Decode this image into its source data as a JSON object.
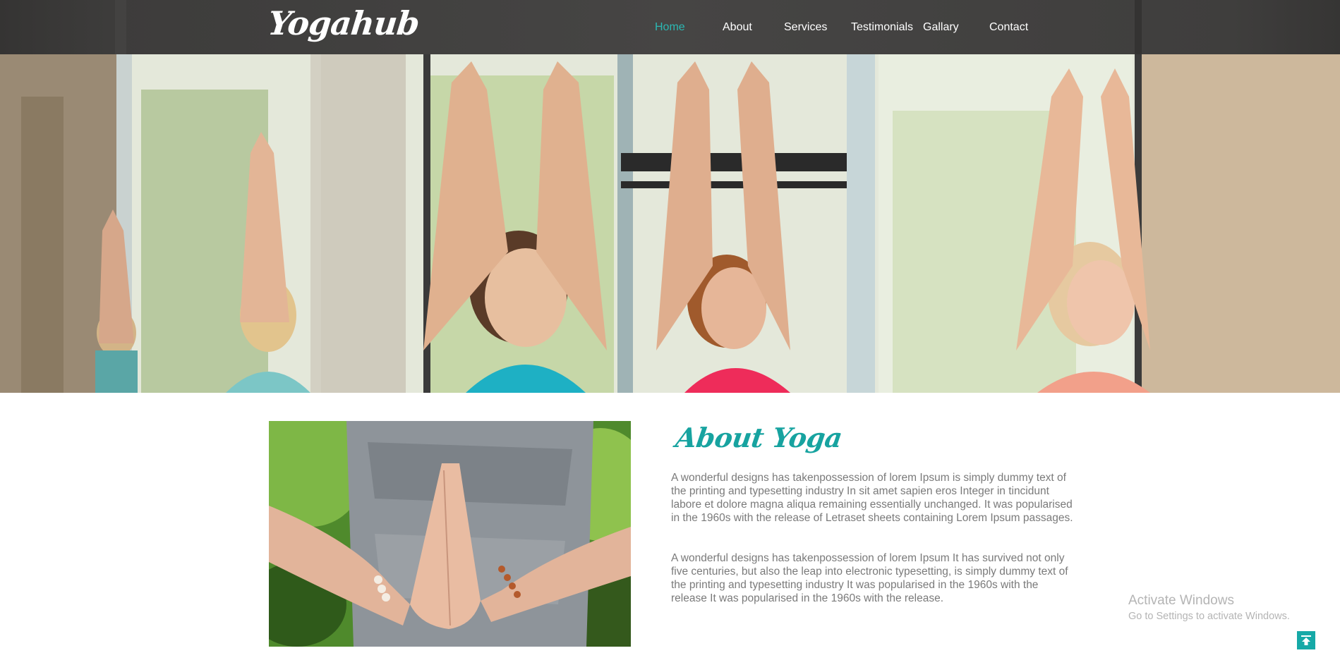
{
  "brand": {
    "logo": "Yogahub"
  },
  "nav": {
    "items": [
      {
        "label": "Home",
        "active": true
      },
      {
        "label": "About",
        "active": false
      },
      {
        "label": "Services",
        "active": false
      },
      {
        "label": "Testimonials",
        "active": false
      },
      {
        "label": "Gallary",
        "active": false
      },
      {
        "label": "Contact",
        "active": false
      }
    ]
  },
  "about": {
    "title": "About Yoga",
    "paragraphs": [
      "A wonderful designs has takenpossession of lorem Ipsum is simply dummy text of the printing and typesetting industry In sit amet sapien eros Integer in tincidunt labore et dolore magna aliqua remaining essentially unchanged. It was popularised in the 1960s with the release of Letraset sheets containing Lorem Ipsum passages.",
      "A wonderful designs has takenpossession of lorem Ipsum It has survived not only five centuries, but also the leap into electronic typesetting, is simply dummy text of the printing and typesetting industry It was popularised in the 1960s with the release It was popularised in the 1960s with the release."
    ]
  },
  "watermark": {
    "line1": "Activate Windows",
    "line2": "Go to Settings to activate Windows."
  },
  "colors": {
    "accent": "#17a3a0",
    "header_bg": "#444342",
    "body_text": "#7a7a7a"
  },
  "icons": {
    "back_to_top": "arrow-up-icon"
  }
}
